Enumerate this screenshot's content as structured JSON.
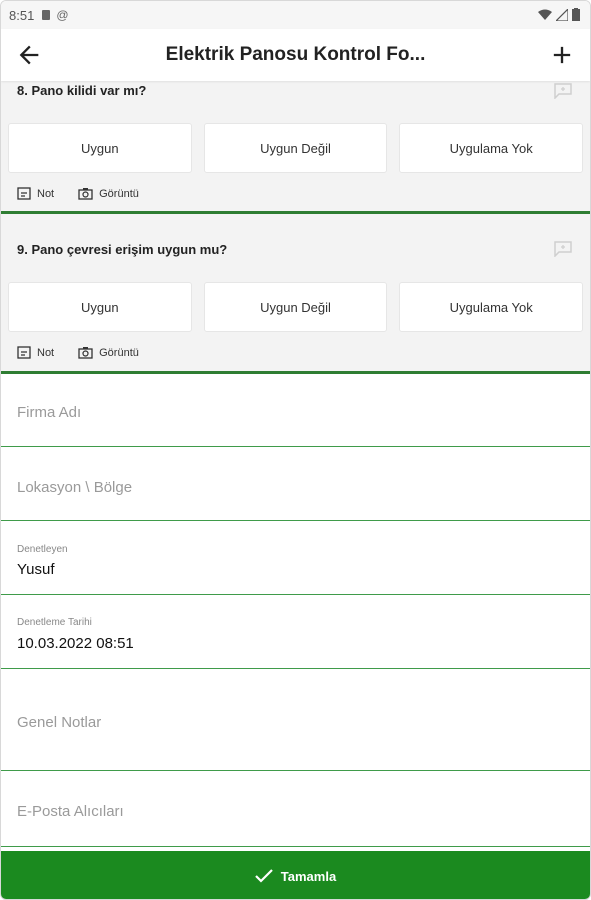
{
  "status_bar": {
    "time": "8:51"
  },
  "app_bar": {
    "title": "Elektrik Panosu Kontrol Fo..."
  },
  "questions": [
    {
      "title": "8. Pano kilidi var mı?",
      "options": [
        "Uygun",
        "Uygun Değil",
        "Uygulama Yok"
      ],
      "note_label": "Not",
      "image_label": "Görüntü"
    },
    {
      "title": "9. Pano çevresi erişim uygun mu?",
      "options": [
        "Uygun",
        "Uygun Değil",
        "Uygulama Yok"
      ],
      "note_label": "Not",
      "image_label": "Görüntü"
    }
  ],
  "fields": {
    "firma": {
      "placeholder": "Firma Adı"
    },
    "lokasyon": {
      "placeholder": "Lokasyon \\ Bölge"
    },
    "denetleyen": {
      "label": "Denetleyen",
      "value": "Yusuf"
    },
    "tarih": {
      "label": "Denetleme Tarihi",
      "value": "10.03.2022 08:51"
    },
    "notlar": {
      "placeholder": "Genel Notlar"
    },
    "eposta": {
      "placeholder": "E-Posta Alıcıları"
    }
  },
  "complete_button": {
    "label": "Tamamla"
  },
  "colors": {
    "accent": "#2e7d32",
    "button": "#1b8a1f",
    "section_bg": "#f3f3f3"
  }
}
